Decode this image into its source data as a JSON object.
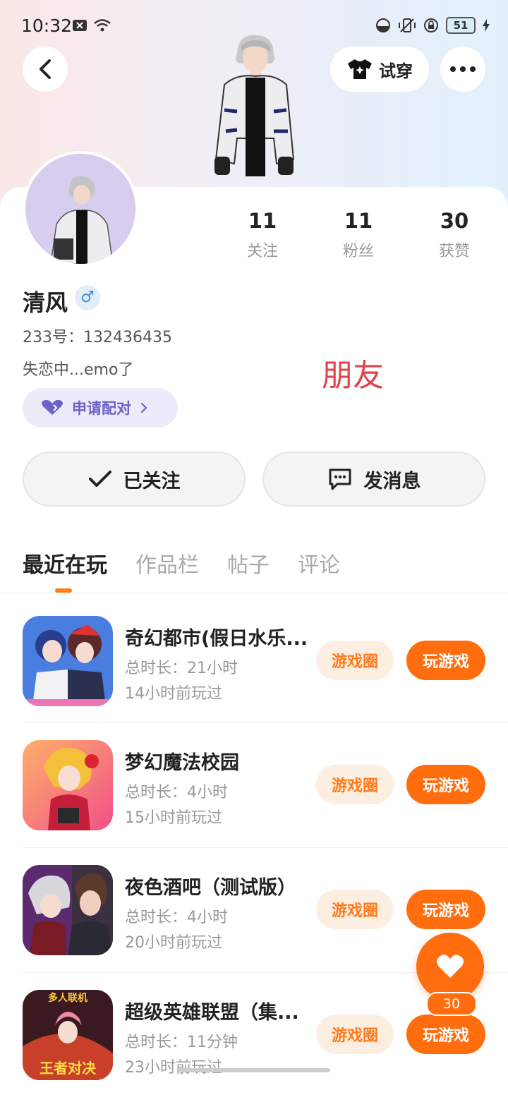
{
  "status_bar": {
    "time": "10:32",
    "battery": "51"
  },
  "header": {
    "try_on_label": "试穿"
  },
  "profile": {
    "name": "清风",
    "gender_symbol": "♂",
    "uid": "233号：132436435",
    "bio": "失恋中...emo了",
    "relation": "朋友",
    "pair_label": "申请配对",
    "stats": [
      {
        "value": "11",
        "label": "关注"
      },
      {
        "value": "11",
        "label": "粉丝"
      },
      {
        "value": "30",
        "label": "获赞"
      }
    ]
  },
  "actions": {
    "follow_label": "已关注",
    "message_label": "发消息"
  },
  "tabs": [
    "最近在玩",
    "作品栏",
    "帖子",
    "评论"
  ],
  "games": [
    {
      "title": "奇幻都市(假日水乐...",
      "duration": "总时长：21小时",
      "last_played": "14小时前玩过",
      "circle_label": "游戏圈",
      "play_label": "玩游戏"
    },
    {
      "title": "梦幻魔法校园",
      "duration": "总时长：4小时",
      "last_played": "15小时前玩过",
      "circle_label": "游戏圈",
      "play_label": "玩游戏"
    },
    {
      "title": "夜色酒吧（测试版）",
      "duration": "总时长：4小时",
      "last_played": "20小时前玩过",
      "circle_label": "游戏圈",
      "play_label": "玩游戏"
    },
    {
      "title": "超级英雄联盟（集...",
      "duration": "总时长：11分钟",
      "last_played": "23小时前玩过",
      "circle_label": "游戏圈",
      "play_label": "玩游戏",
      "icon_text_top": "多人联机",
      "icon_text_bottom": "王者对决"
    }
  ],
  "float_like": {
    "count": "30"
  },
  "colors": {
    "accent": "#ff6d0f",
    "accent_light": "#fdeee2",
    "pair": "#6c63c9",
    "relation": "#e0434a"
  }
}
